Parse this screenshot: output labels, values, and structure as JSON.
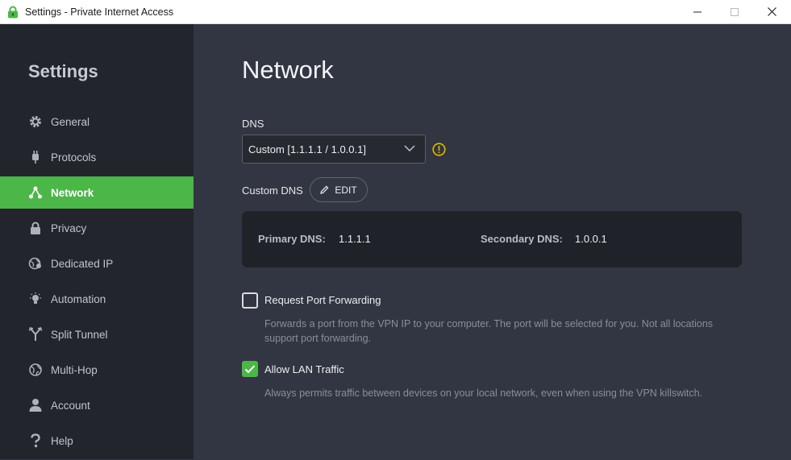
{
  "window": {
    "title": "Settings - Private Internet Access"
  },
  "sidebar": {
    "heading": "Settings",
    "items": [
      {
        "label": "General",
        "icon": "gear-icon",
        "active": false
      },
      {
        "label": "Protocols",
        "icon": "plug-icon",
        "active": false
      },
      {
        "label": "Network",
        "icon": "network-icon",
        "active": true
      },
      {
        "label": "Privacy",
        "icon": "lock-icon",
        "active": false
      },
      {
        "label": "Dedicated IP",
        "icon": "globe-pin-icon",
        "active": false
      },
      {
        "label": "Automation",
        "icon": "lightbulb-icon",
        "active": false
      },
      {
        "label": "Split Tunnel",
        "icon": "split-icon",
        "active": false
      },
      {
        "label": "Multi-Hop",
        "icon": "globe-icon",
        "active": false
      },
      {
        "label": "Account",
        "icon": "user-icon",
        "active": false
      },
      {
        "label": "Help",
        "icon": "question-icon",
        "active": false
      }
    ]
  },
  "main": {
    "title": "Network",
    "dns_label": "DNS",
    "dns_selected": "Custom [1.1.1.1 / 1.0.0.1]",
    "custom_dns_label": "Custom DNS",
    "edit_label": "EDIT",
    "primary_dns_key": "Primary DNS:",
    "primary_dns_value": "1.1.1.1",
    "secondary_dns_key": "Secondary DNS:",
    "secondary_dns_value": "1.0.0.1",
    "port_forwarding": {
      "label": "Request Port Forwarding",
      "checked": false,
      "desc_line1": "Forwards a port from the VPN IP to your computer. The port will be selected for you. Not all locations",
      "desc_line2": "support port forwarding."
    },
    "lan_traffic": {
      "label": "Allow LAN Traffic",
      "checked": true,
      "desc": "Always permits traffic between devices on your local network, even when using the VPN killswitch."
    }
  },
  "colors": {
    "accent": "#4cb649",
    "sidebar_bg": "#22252c",
    "main_bg": "#323642",
    "panel_bg": "#1f2228",
    "warning": "#e5b800"
  }
}
